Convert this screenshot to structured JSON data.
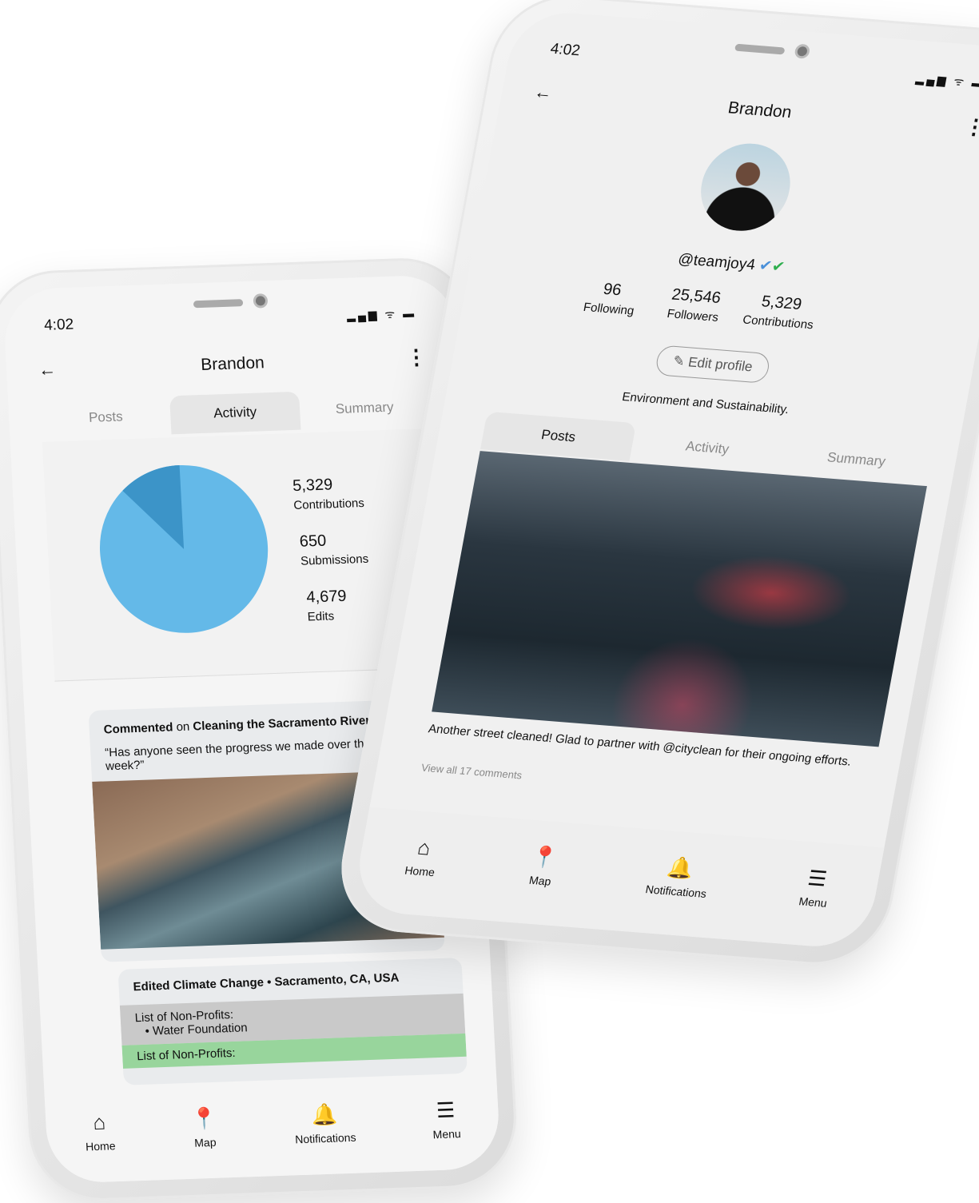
{
  "status": {
    "time": "4:02"
  },
  "left": {
    "title": "Brandon",
    "tabs": [
      "Posts",
      "Activity",
      "Summary"
    ],
    "active_tab": "Activity",
    "stats": [
      {
        "value": "5,329",
        "label": "Contributions"
      },
      {
        "value": "650",
        "label": "Submissions"
      },
      {
        "value": "4,679",
        "label": "Edits"
      }
    ],
    "chart_colors": {
      "edits": "#64b9e8",
      "submissions": "#3c94c8"
    },
    "comment_card": {
      "action": "Commented",
      "prep": "on",
      "target": "Cleaning the Sacramento River:",
      "quote": "“Has anyone seen the progress we made over the last week?”"
    },
    "edit_card": {
      "title": "Edited Climate Change • Sacramento, CA, USA",
      "old_label": "List of Non-Profits:",
      "old_item": "Water Foundation",
      "new_label": "List of Non-Profits:"
    }
  },
  "right": {
    "title": "Brandon",
    "handle": "@teamjoy4",
    "stats": [
      {
        "value": "96",
        "label": "Following"
      },
      {
        "value": "25,546",
        "label": "Followers"
      },
      {
        "value": "5,329",
        "label": "Contributions"
      }
    ],
    "edit_profile": "Edit profile",
    "bio": "Environment and Sustainability.",
    "tabs": [
      "Posts",
      "Activity",
      "Summary"
    ],
    "active_tab": "Posts",
    "caption": "Another street cleaned! Glad to partner with @cityclean for their ongoing efforts.",
    "comments_link": "View all 17 comments"
  },
  "nav": [
    "Home",
    "Map",
    "Notifications",
    "Menu"
  ]
}
